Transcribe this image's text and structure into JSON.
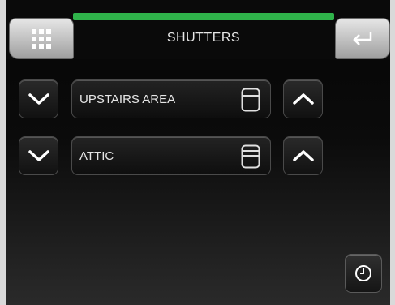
{
  "header": {
    "title": "SHUTTERS",
    "accent_color": "#2fb34a"
  },
  "icons": {
    "menu": "grid-menu-icon",
    "back": "return-arrow-icon",
    "timer": "clock-icon",
    "shutter": "shutter-icon"
  },
  "shutters": [
    {
      "label": "UPSTAIRS AREA"
    },
    {
      "label": "ATTIC"
    }
  ]
}
